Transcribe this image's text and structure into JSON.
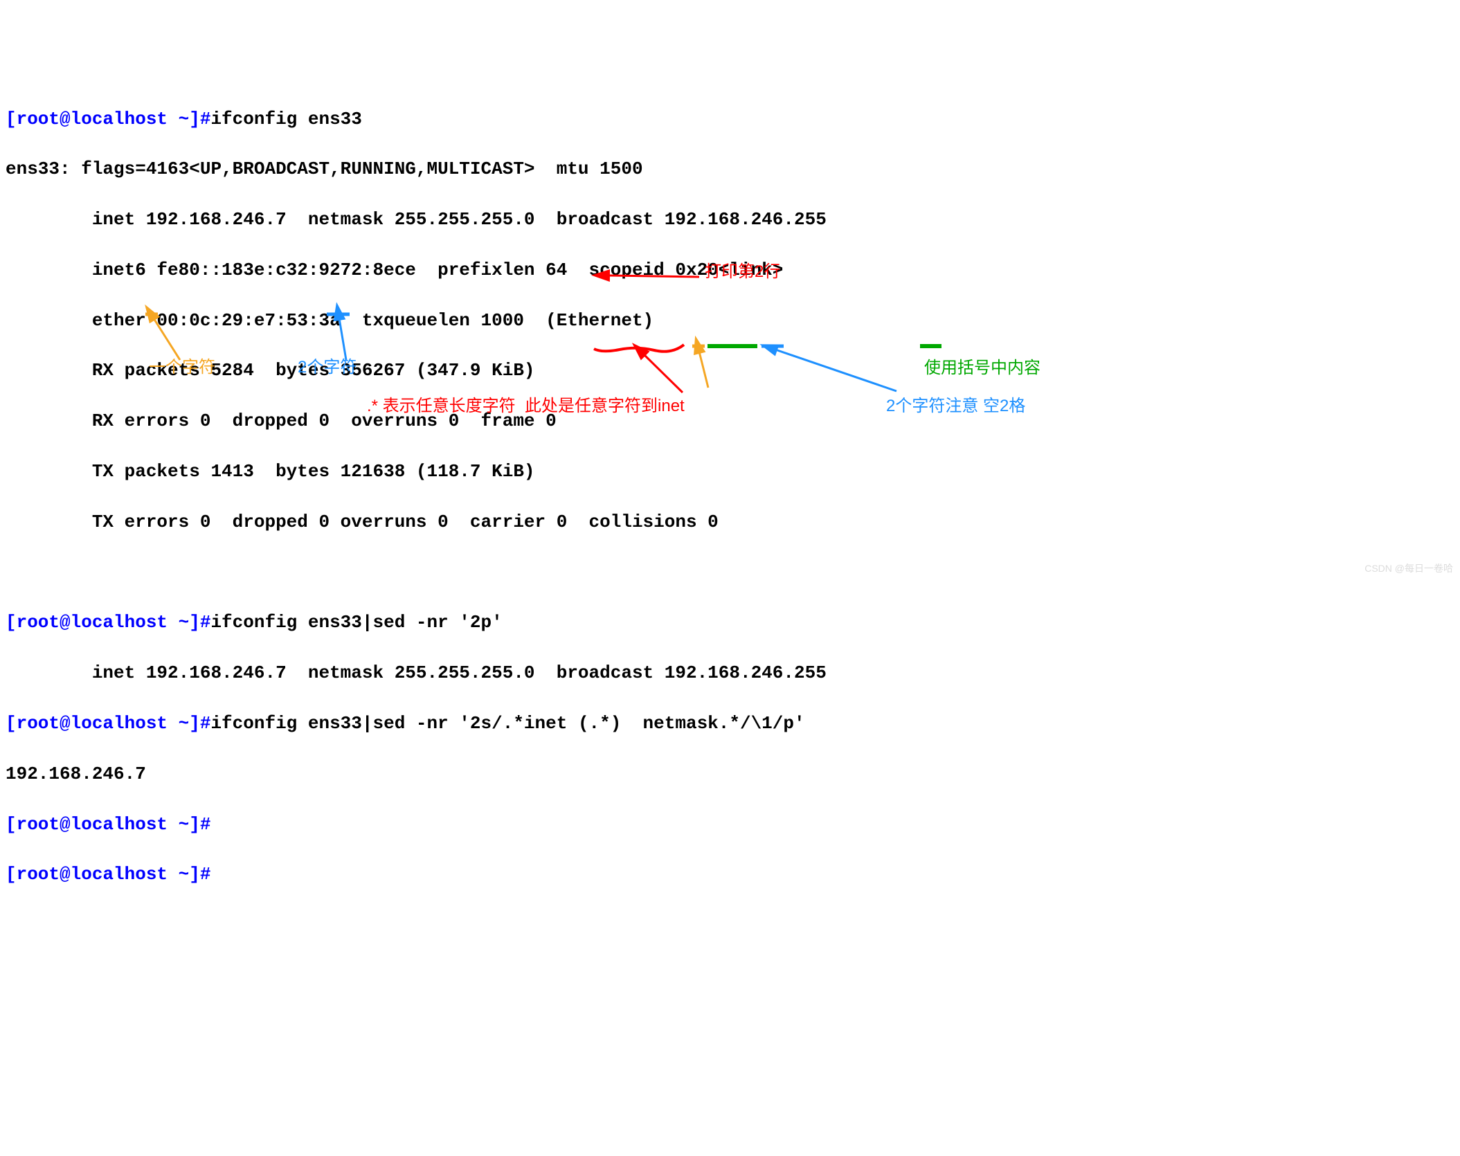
{
  "prompt1": {
    "prefix": "[root@localhost ~]#",
    "cmd": "ifconfig ens33"
  },
  "ifconfig_output": {
    "l1": "ens33: flags=4163<UP,BROADCAST,RUNNING,MULTICAST>  mtu 1500",
    "l2": "        inet 192.168.246.7  netmask 255.255.255.0  broadcast 192.168.246.255",
    "l3": "        inet6 fe80::183e:c32:9272:8ece  prefixlen 64  scopeid 0x20<link>",
    "l4": "        ether 00:0c:29:e7:53:3a  txqueuelen 1000  (Ethernet)",
    "l5": "        RX packets 5284  bytes 356267 (347.9 KiB)",
    "l6": "        RX errors 0  dropped 0  overruns 0  frame 0",
    "l7": "        TX packets 1413  bytes 121638 (118.7 KiB)",
    "l8": "        TX errors 0  dropped 0 overruns 0  carrier 0  collisions 0"
  },
  "prompt2": {
    "prefix": "[root@localhost ~]#",
    "cmd": "ifconfig ens33|sed -nr '2p'"
  },
  "sed_output1": "        inet 192.168.246.7  netmask 255.255.255.0  broadcast 192.168.246.255",
  "prompt3": {
    "prefix": "[root@localhost ~]#",
    "cmd": "ifconfig ens33|sed -nr '2s/.*inet (.*)  netmask.*/\\1/p'"
  },
  "sed_output2": "192.168.246.7",
  "prompt4": {
    "prefix": "[root@localhost ~]#"
  },
  "prompt5": {
    "prefix": "[root@localhost ~]#"
  },
  "annotations": {
    "print_line2": "打印第2行",
    "one_char": "一个字符",
    "two_chars_left": "2个字符",
    "dotstar_note": ".* 表示任意长度字符  此处是任意字符到inet",
    "two_chars_space": "2个字符注意 空2格",
    "use_parentheses": "使用括号中内容"
  },
  "watermark": "CSDN @每日一卷哈"
}
